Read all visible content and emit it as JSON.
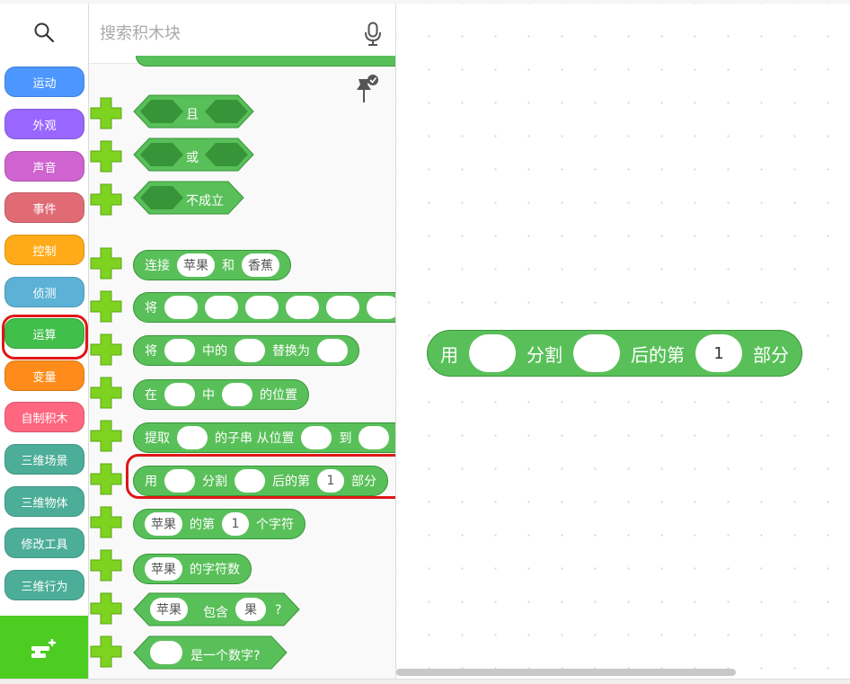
{
  "search": {
    "placeholder": "搜索积木块"
  },
  "categories": [
    {
      "label": "运动",
      "color": "#4c97ff"
    },
    {
      "label": "外观",
      "color": "#9966ff"
    },
    {
      "label": "声音",
      "color": "#cf63cf"
    },
    {
      "label": "事件",
      "color": "#e06b75"
    },
    {
      "label": "控制",
      "color": "#ffab19"
    },
    {
      "label": "侦测",
      "color": "#5cb1d6"
    },
    {
      "label": "运算",
      "color": "#40bf4a",
      "selected": true
    },
    {
      "label": "变量",
      "color": "#ff8c1a"
    },
    {
      "label": "自制积木",
      "color": "#ff6680"
    },
    {
      "label": "三维场景",
      "color": "#4cae98"
    },
    {
      "label": "三维物体",
      "color": "#4cae98"
    },
    {
      "label": "修改工具",
      "color": "#4cae98"
    },
    {
      "label": "三维行为",
      "color": "#4cae98"
    }
  ],
  "palette": {
    "and": {
      "label": "且"
    },
    "or": {
      "label": "或"
    },
    "not": {
      "label": "不成立"
    },
    "join": {
      "label1": "连接",
      "arg1": "苹果",
      "label2": "和",
      "arg2": "香蕉"
    },
    "multi": {
      "label": "将"
    },
    "replace": {
      "label1": "将",
      "label2": "中的",
      "label3": "替换为"
    },
    "position": {
      "label1": "在",
      "label2": "中",
      "label3": "的位置"
    },
    "substring": {
      "label1": "提取",
      "label2": "的子串 从位置",
      "label3": "到"
    },
    "split": {
      "label1": "用",
      "label2": "分割",
      "label3": "后的第",
      "num": "1",
      "label4": "部分"
    },
    "letter": {
      "arg": "苹果",
      "label1": "的第",
      "num": "1",
      "label2": "个字符"
    },
    "length": {
      "arg": "苹果",
      "label": "的字符数"
    },
    "contains": {
      "arg1": "苹果",
      "label": "包含",
      "arg2": "果",
      "q": "?"
    },
    "isnum": {
      "label": "是一个数字?"
    }
  },
  "workspace": {
    "block": {
      "label1": "用",
      "label2": "分割",
      "label3": "后的第",
      "num": "1",
      "label4": "部分"
    }
  },
  "colors": {
    "operator": "#59c059",
    "operator_dark": "#389438",
    "add": "#7ed321",
    "highlight": "#e01616"
  }
}
